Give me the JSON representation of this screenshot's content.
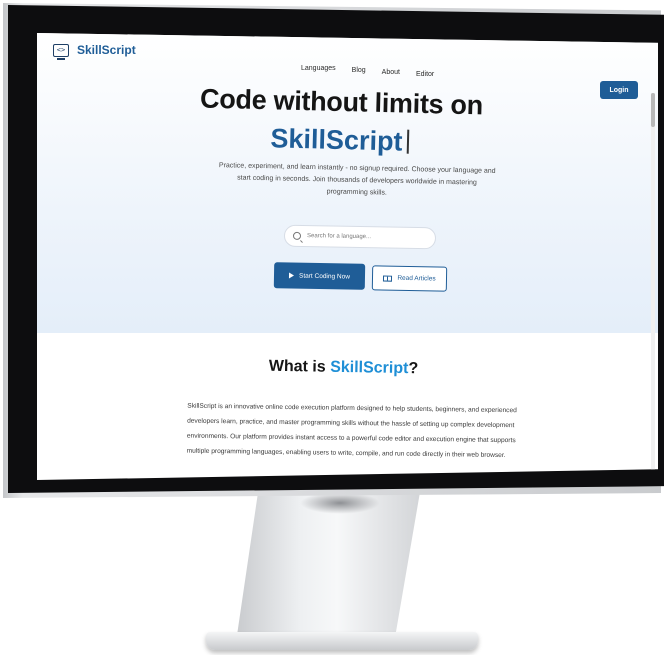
{
  "header": {
    "brand": "SkillScript",
    "nav": [
      "Languages",
      "Blog",
      "About",
      "Editor"
    ],
    "login_label": "Login"
  },
  "hero": {
    "title_line1": "Code without limits on",
    "title_brand": "SkillScript",
    "description": "Practice, experiment, and learn instantly - no signup required. Choose your language and start coding in seconds. Join thousands of developers worldwide in mastering programming skills.",
    "search_placeholder": "Search for a language...",
    "primary_button": "Start Coding Now",
    "secondary_button": "Read Articles"
  },
  "about": {
    "title_prefix": "What is ",
    "title_brand": "SkillScript",
    "title_suffix": "?",
    "body": "SkillScript is an innovative online code execution platform designed to help students, beginners, and experienced developers learn, practice, and master programming skills without the hassle of setting up complex development environments. Our platform provides instant access to a powerful code editor and execution engine that supports multiple programming languages, enabling users to write, compile, and run code directly in their web browser."
  },
  "colors": {
    "brand_blue": "#1f5d97",
    "accent_blue": "#1f8fd6",
    "hero_bg": "#e4eef9"
  },
  "icons": [
    "monitor-code-icon",
    "search-icon",
    "play-icon",
    "book-icon"
  ]
}
